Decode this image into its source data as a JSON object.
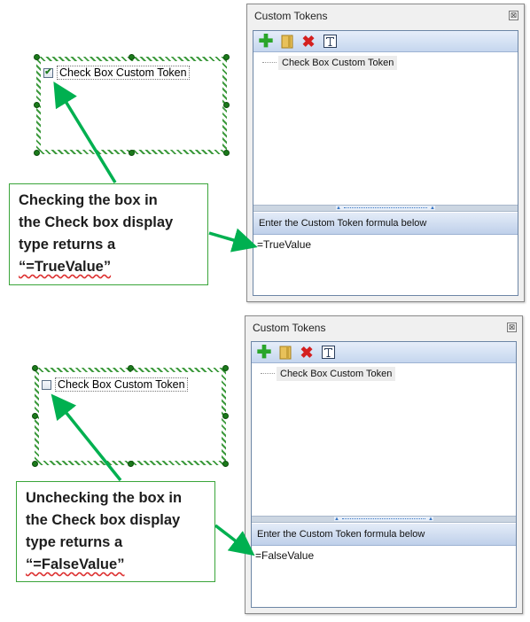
{
  "top": {
    "checkbox_label": "Check Box Custom Token",
    "checkbox_checked": true,
    "callout_lines": [
      "Checking the box in",
      "the Check box display",
      "type returns  a"
    ],
    "callout_quote": "“=TrueValue”",
    "panel": {
      "title": "Custom Tokens",
      "close_glyph": "⊠",
      "tree_item": "Check Box Custom Token",
      "formula_header": "Enter the Custom Token formula below",
      "formula_value": "=TrueValue"
    }
  },
  "bottom": {
    "checkbox_label": "Check Box Custom Token",
    "checkbox_checked": false,
    "callout_lines": [
      "Unchecking the box in",
      "the Check box display",
      "type returns  a"
    ],
    "callout_quote": "“=FalseValue”",
    "panel": {
      "title": "Custom Tokens",
      "close_glyph": "⊠",
      "tree_item": "Check Box Custom Token",
      "formula_header": "Enter the Custom Token formula below",
      "formula_value": "=FalseValue"
    }
  },
  "toolbar_icons": [
    "add-icon",
    "folder-icon",
    "delete-icon",
    "text-format-icon"
  ],
  "colors": {
    "callout_border": "#3aa53a",
    "arrow": "#00b050",
    "handle": "#1b7a1b",
    "toolbar": "#c5d6ee"
  }
}
